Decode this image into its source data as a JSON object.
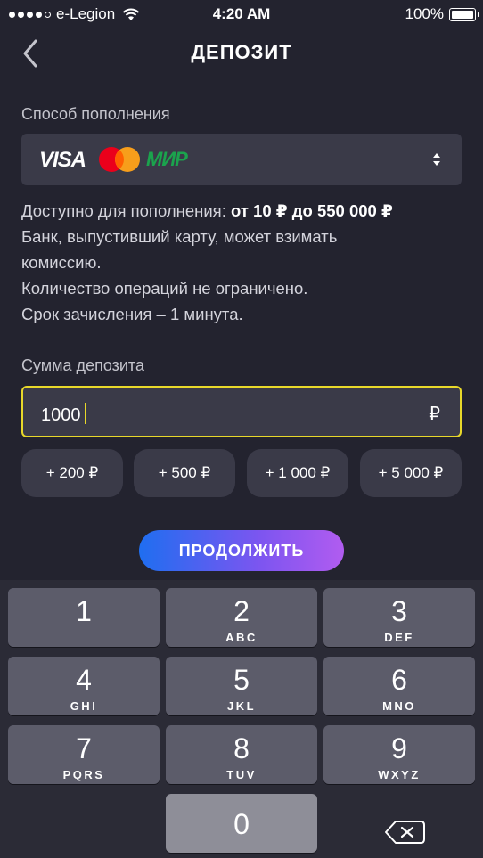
{
  "status_bar": {
    "carrier": "e-Legion",
    "time": "4:20 AM",
    "battery": "100%"
  },
  "header": {
    "title": "ДЕПОЗИТ"
  },
  "payment_method": {
    "label": "Способ пополнения",
    "brands": {
      "visa": "VISA",
      "mir": "МИР"
    }
  },
  "info": {
    "line1_prefix": "Доступно для пополнения: ",
    "line1_bold": "от 10 ₽ до 550 000 ₽",
    "line2": "Банк, выпустивший карту, может взимать",
    "line3": "комиссию.",
    "line4": "Количество операций не ограничено.",
    "line5": "Срок зачисления – 1 минута."
  },
  "amount": {
    "label": "Сумма депозита",
    "value": "1000",
    "currency": "₽"
  },
  "quick_amounts": [
    "+ 200 ₽",
    "+ 500 ₽",
    "+ 1 000 ₽",
    "+ 5 000 ₽"
  ],
  "continue_label": "ПРОДОЛЖИТЬ",
  "keyboard": {
    "keys": [
      {
        "digit": "1",
        "letters": ""
      },
      {
        "digit": "2",
        "letters": "ABC"
      },
      {
        "digit": "3",
        "letters": "DEF"
      },
      {
        "digit": "4",
        "letters": "GHI"
      },
      {
        "digit": "5",
        "letters": "JKL"
      },
      {
        "digit": "6",
        "letters": "MNO"
      },
      {
        "digit": "7",
        "letters": "PQRS"
      },
      {
        "digit": "8",
        "letters": "TUV"
      },
      {
        "digit": "9",
        "letters": "WXYZ"
      },
      {
        "digit": "0",
        "letters": ""
      }
    ]
  },
  "colors": {
    "background": "#23232f",
    "field": "#3a3a48",
    "input_border": "#e8d82a",
    "button_gradient_start": "#1f6ef0",
    "button_gradient_end": "#b15cf0",
    "mir_green": "#1ba34d"
  }
}
